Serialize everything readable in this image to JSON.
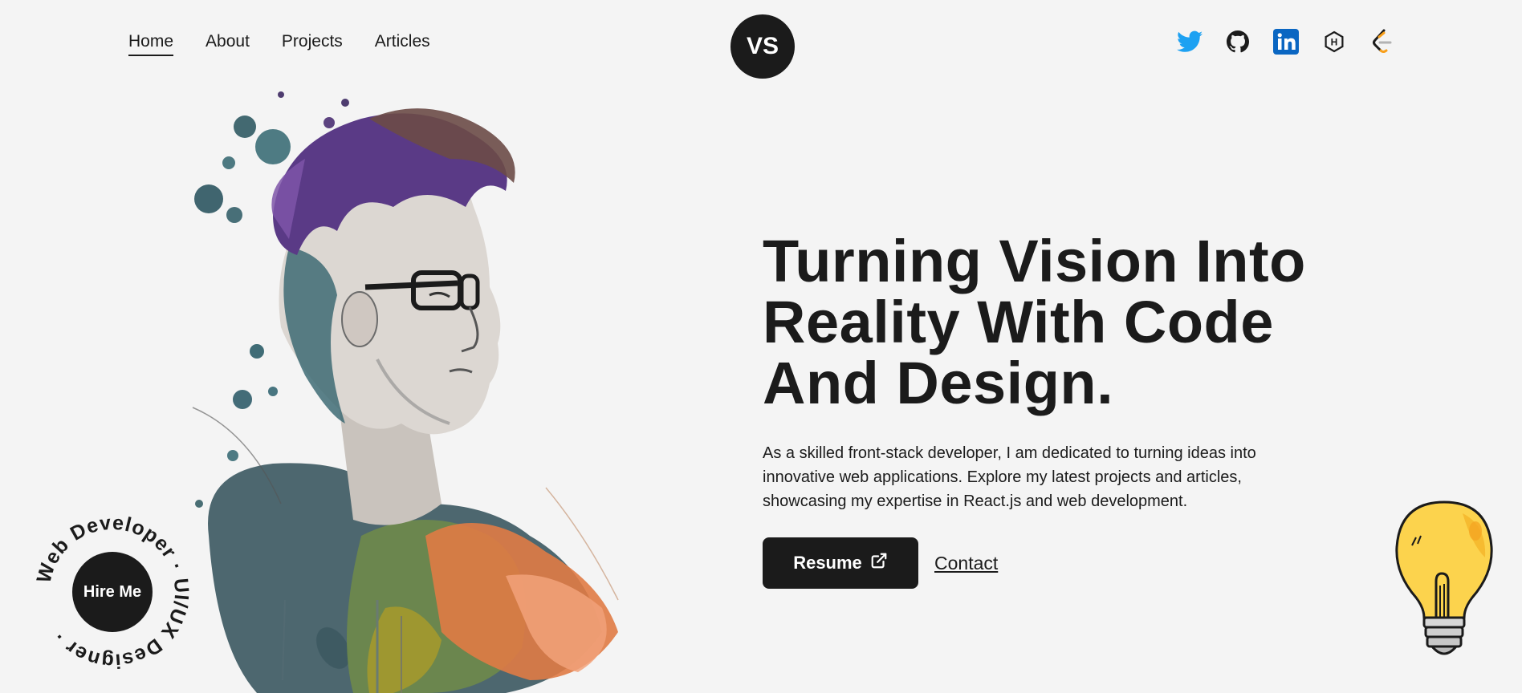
{
  "nav": {
    "links": [
      {
        "label": "Home",
        "active": true
      },
      {
        "label": "About",
        "active": false
      },
      {
        "label": "Projects",
        "active": false
      },
      {
        "label": "Articles",
        "active": false
      }
    ],
    "logo_text": "VS",
    "socials": [
      "twitter-icon",
      "github-icon",
      "linkedin-icon",
      "hashnode-icon",
      "leetcode-icon"
    ]
  },
  "hero": {
    "title_lines": [
      "Turning Vision Into",
      "Reality With Code",
      "And Design."
    ],
    "description_lines": [
      "As a skilled front-stack developer, I am dedicated to turning ideas into",
      "innovative web applications. Explore my latest projects and articles,",
      "showcasing my expertise in React.js and web development."
    ],
    "resume_label": "Resume",
    "contact_label": "Contact"
  },
  "badge": {
    "button_label": "Hire Me",
    "ring_text": "Web Developer · UI/UX Designer · "
  },
  "colors": {
    "background": "#f4f4f4",
    "dark": "#1b1b1b",
    "twitter": "#1DA1F2",
    "linkedin": "#0A66C2",
    "bulb_yellow": "#FCD34D"
  }
}
